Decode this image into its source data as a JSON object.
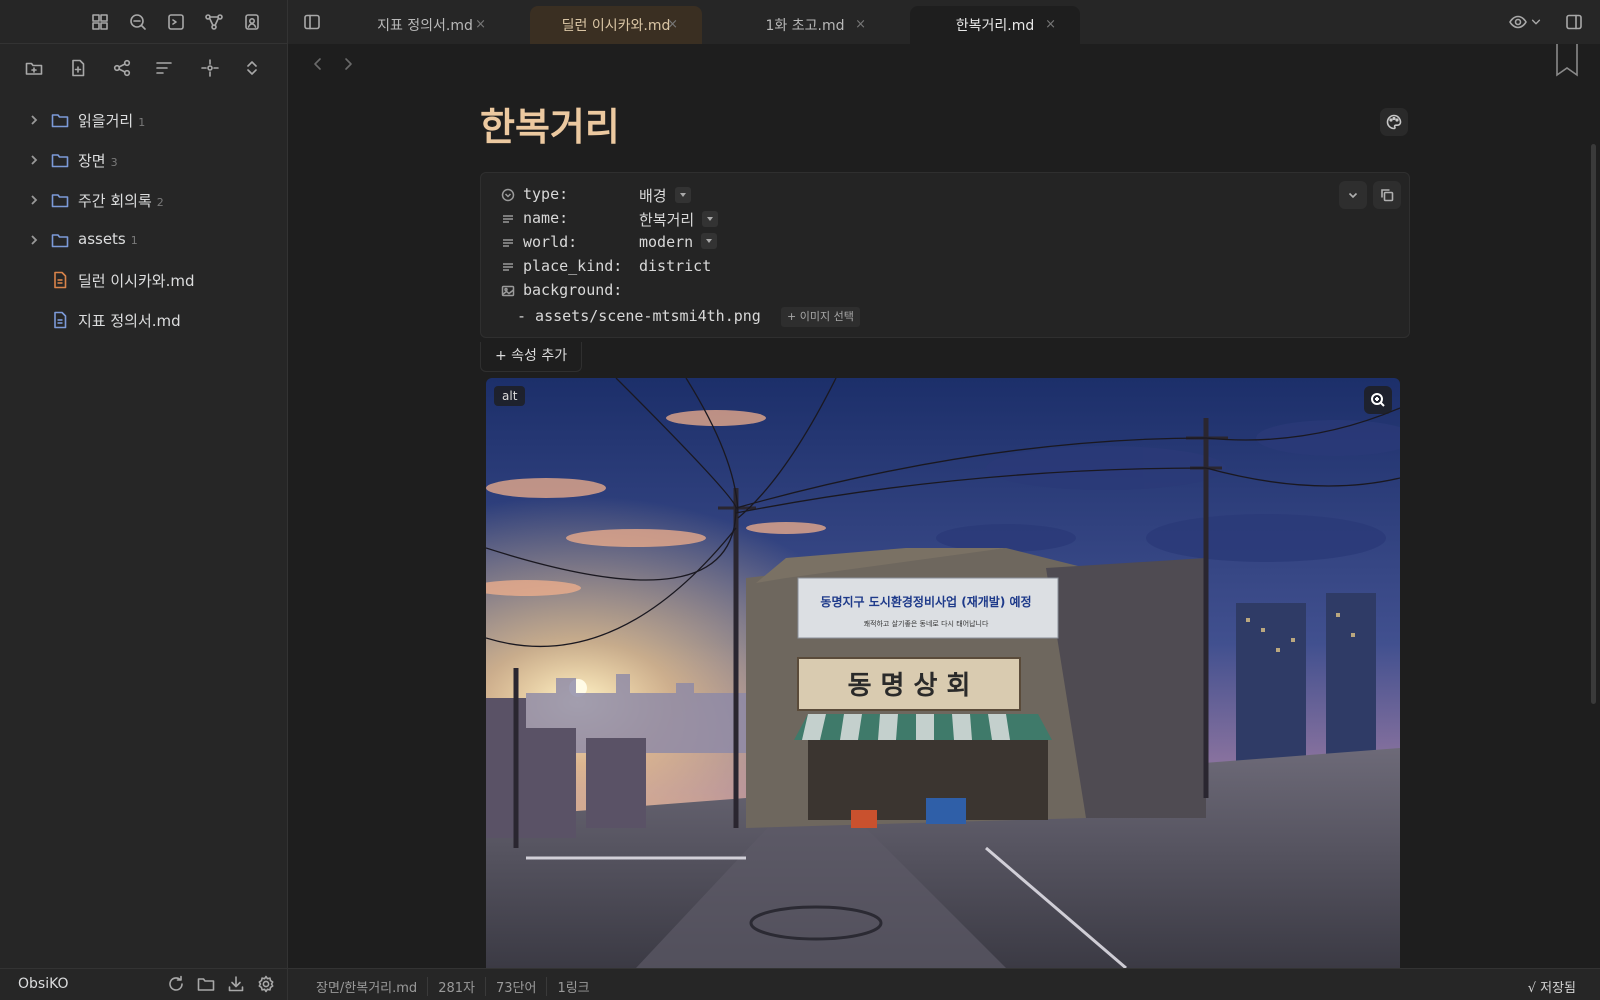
{
  "sidebar": {
    "ribbon_icons": [
      "dashboard-icon",
      "search-icon",
      "terminal-icon",
      "graph-icon",
      "contact-icon"
    ],
    "nav_tools": [
      "new-folder-icon",
      "new-note-icon",
      "tree-icon",
      "sort-icon",
      "target-icon",
      "expand-icon"
    ],
    "tree": [
      {
        "type": "folder",
        "label": "읽을거리",
        "count": "1"
      },
      {
        "type": "folder",
        "label": "장면",
        "count": "3"
      },
      {
        "type": "folder",
        "label": "주간 회의록",
        "count": "2"
      },
      {
        "type": "folder",
        "label": "assets",
        "count": "1"
      },
      {
        "type": "file",
        "label": "딜런 이시카와.md",
        "color": "#d9834a"
      },
      {
        "type": "file",
        "label": "지표 정의서.md",
        "color": "#7c9ad8"
      }
    ],
    "vault_name": "ObsiKO"
  },
  "tabs": [
    {
      "label": "지표 정의서.md",
      "close": "×"
    },
    {
      "label": "딜런 이시카와.md",
      "close": "×"
    },
    {
      "label": "1화 초고.md",
      "close": "×"
    },
    {
      "label": "한복거리.md",
      "close": "×"
    }
  ],
  "note": {
    "title": "한복거리",
    "properties": [
      {
        "key": "type:",
        "value": "배경"
      },
      {
        "key": "name:",
        "value": "한복거리"
      },
      {
        "key": "world:",
        "value": "modern"
      },
      {
        "key": "place_kind:",
        "value": "district"
      },
      {
        "key": "background:",
        "value": ""
      }
    ],
    "background_item": "- assets/scene-mtsmi4th.png",
    "pick_image_label": "+ 이미지 선택",
    "add_property_label": "+ 속성 추가",
    "image": {
      "alt_label": "alt",
      "banner_main": "동명지구 도시환경정비사업 (재개발) 예정",
      "banner_sub": "쾌적하고 살기좋은 동네로 다시 태어납니다",
      "shop_sign": "동 명 상 회"
    }
  },
  "status": {
    "path": "장면/한복거리.md",
    "chars": "281자",
    "words": "73단어",
    "links": "1링크",
    "saved": "√ 저장됨"
  },
  "colors": {
    "accent_title": "#ecc9a0",
    "folder_icon": "#7c9ad8"
  }
}
